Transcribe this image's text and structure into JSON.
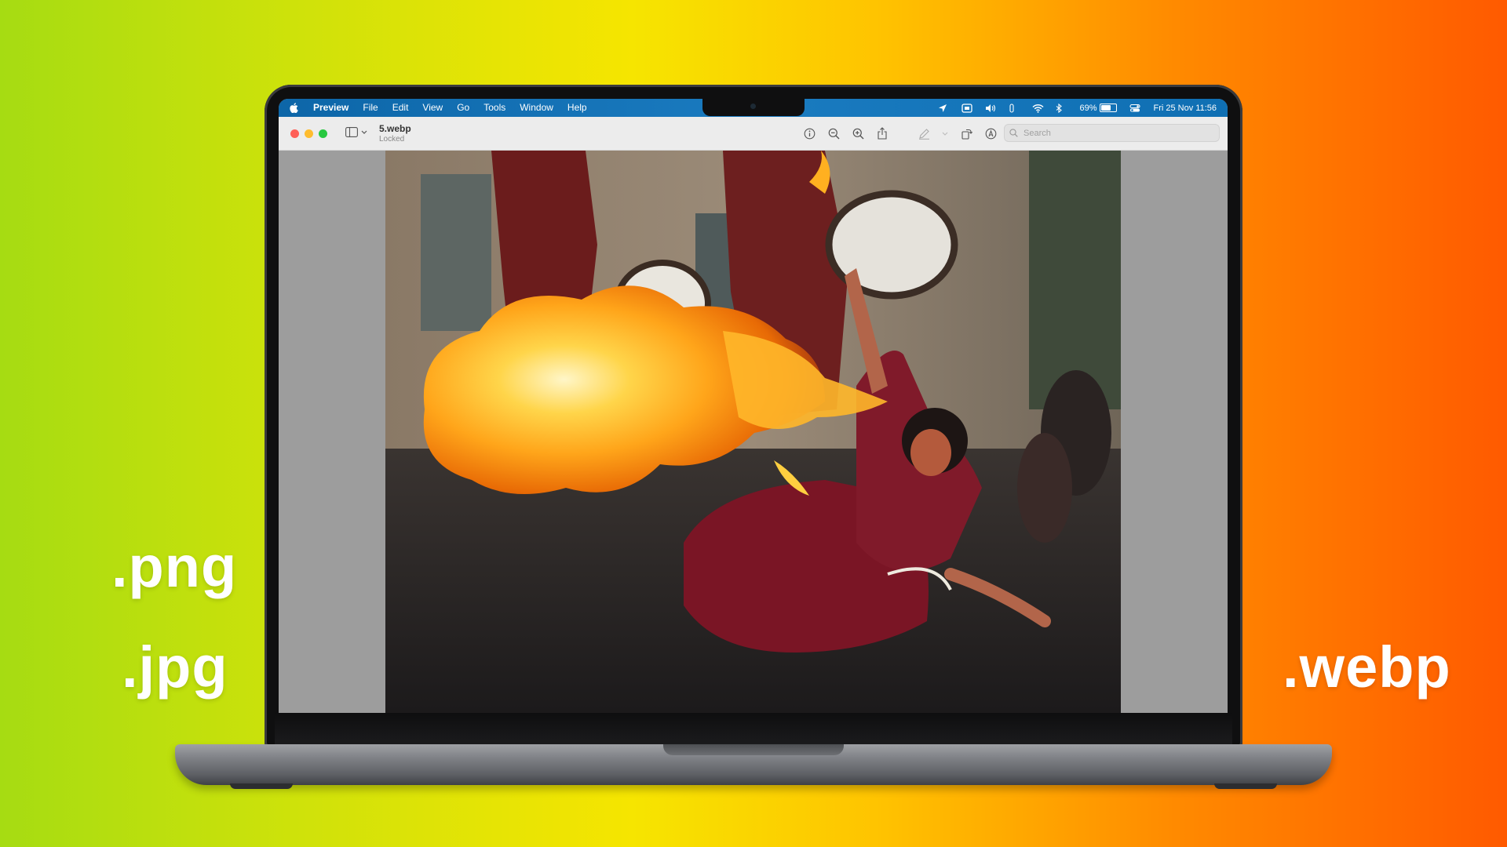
{
  "background": {
    "gradient_colors": [
      "#a6dc12",
      "#f6e500",
      "#ffc400",
      "#ff5a00"
    ]
  },
  "extensions": {
    "png": ".png",
    "jpg": ".jpg",
    "webp": ".webp"
  },
  "menubar": {
    "app": "Preview",
    "items": [
      "File",
      "Edit",
      "View",
      "Go",
      "Tools",
      "Window",
      "Help"
    ],
    "battery_percent": "69%",
    "battery_level": 0.69,
    "datetime": "Fri 25 Nov  11:56",
    "status_icons": [
      "location-icon",
      "screen-mirroring-icon",
      "volume-icon",
      "siri-icon",
      "wifi-icon",
      "bluetooth-icon",
      "battery-icon",
      "control-center-icon"
    ]
  },
  "window": {
    "document_name": "5.webp",
    "document_status": "Locked",
    "search_placeholder": "Search",
    "toolbar_icons": [
      "info-icon",
      "zoom-out-icon",
      "zoom-in-icon",
      "share-icon",
      "markup-pen-icon",
      "rotate-icon",
      "markup-toolbar-icon"
    ]
  },
  "accent": {
    "menubar": "#1a7bc0",
    "close": "#fe5f57",
    "minimize": "#febc2e",
    "zoom": "#28c840"
  }
}
